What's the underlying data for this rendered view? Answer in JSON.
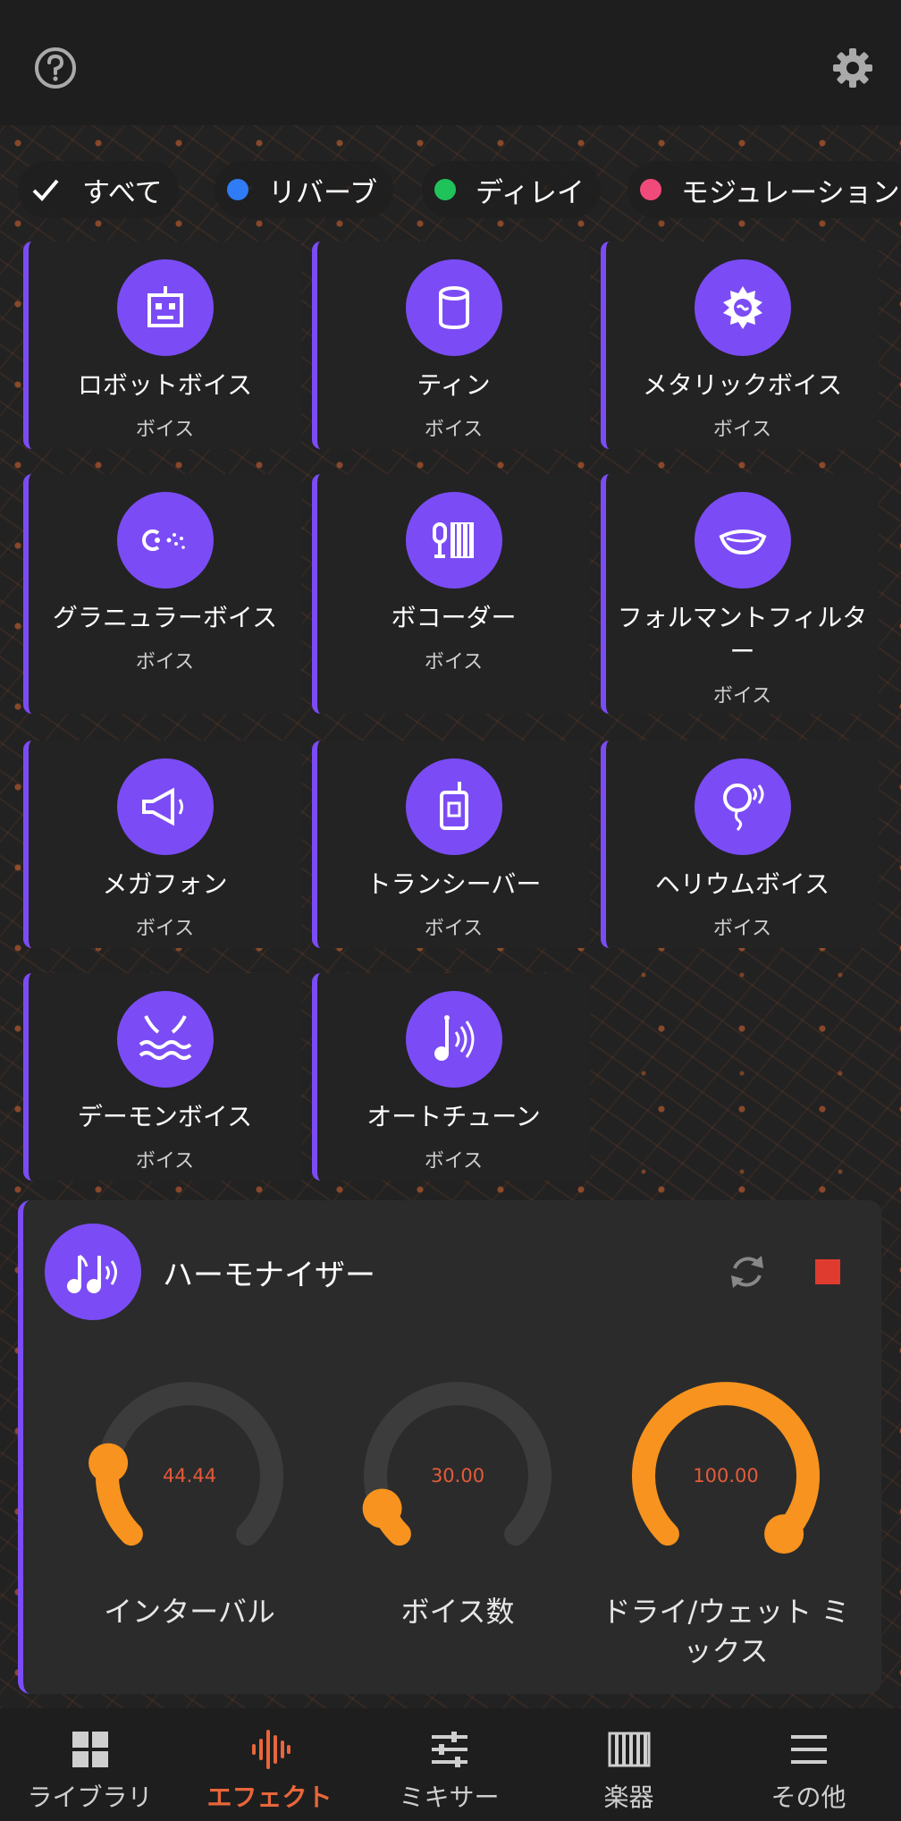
{
  "chips": [
    {
      "label": "すべて",
      "selected": true
    },
    {
      "label": "リバーブ",
      "color": "#2f7cf6"
    },
    {
      "label": "ディレイ",
      "color": "#20c35a"
    },
    {
      "label": "モジュレーション",
      "color": "#f04a7a"
    }
  ],
  "effects": [
    {
      "name": "ロボットボイス",
      "category": "ボイス",
      "icon": "robot-icon"
    },
    {
      "name": "ティン",
      "category": "ボイス",
      "icon": "tin-can-icon"
    },
    {
      "name": "メタリックボイス",
      "category": "ボイス",
      "icon": "metal-gear-icon"
    },
    {
      "name": "グラニュラーボイス",
      "category": "ボイス",
      "icon": "granular-icon"
    },
    {
      "name": "ボコーダー",
      "category": "ボイス",
      "icon": "vocoder-icon"
    },
    {
      "name": "フォルマントフィルター",
      "category": "ボイス",
      "icon": "mouth-icon"
    },
    {
      "name": "メガフォン",
      "category": "ボイス",
      "icon": "megaphone-icon"
    },
    {
      "name": "トランシーバー",
      "category": "ボイス",
      "icon": "walkie-talkie-icon"
    },
    {
      "name": "ヘリウムボイス",
      "category": "ボイス",
      "icon": "balloon-icon"
    },
    {
      "name": "デーモンボイス",
      "category": "ボイス",
      "icon": "demon-icon"
    },
    {
      "name": "オートチューン",
      "category": "ボイス",
      "icon": "music-note-icon"
    }
  ],
  "panel": {
    "title": "ハーモナイザー",
    "icon": "harmonizer-notes-icon",
    "knobs": [
      {
        "label": "インターバル",
        "value": "44.44",
        "fraction": 0.2
      },
      {
        "label": "ボイス数",
        "value": "30.00",
        "fraction": 0.08
      },
      {
        "label": "ドライ/ウェット ミックス",
        "value": "100.00",
        "fraction": 1.0
      }
    ]
  },
  "nav": [
    {
      "label": "ライブラリ",
      "icon": "grid-icon"
    },
    {
      "label": "エフェクト",
      "icon": "waveform-icon",
      "active": true
    },
    {
      "label": "ミキサー",
      "icon": "sliders-icon"
    },
    {
      "label": "楽器",
      "icon": "piano-icon"
    },
    {
      "label": "その他",
      "icon": "menu-icon"
    }
  ],
  "colors": {
    "accent": "#7b4cf5",
    "knob": "#f7931e",
    "active_nav": "#e8663a",
    "stop": "#e03b2f"
  }
}
